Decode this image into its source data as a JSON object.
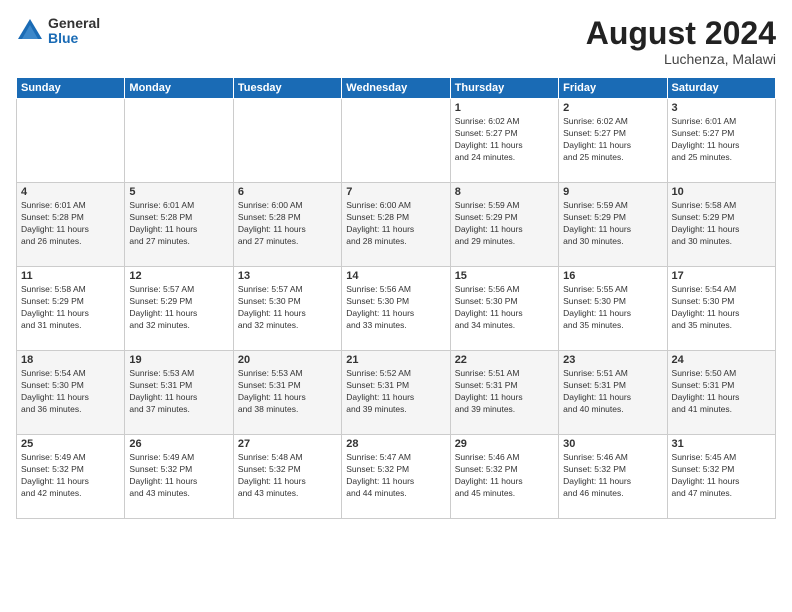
{
  "logo": {
    "general": "General",
    "blue": "Blue"
  },
  "title": "August 2024",
  "location": "Luchenza, Malawi",
  "days_of_week": [
    "Sunday",
    "Monday",
    "Tuesday",
    "Wednesday",
    "Thursday",
    "Friday",
    "Saturday"
  ],
  "weeks": [
    [
      {
        "day": "",
        "info": ""
      },
      {
        "day": "",
        "info": ""
      },
      {
        "day": "",
        "info": ""
      },
      {
        "day": "",
        "info": ""
      },
      {
        "day": "1",
        "info": "Sunrise: 6:02 AM\nSunset: 5:27 PM\nDaylight: 11 hours\nand 24 minutes."
      },
      {
        "day": "2",
        "info": "Sunrise: 6:02 AM\nSunset: 5:27 PM\nDaylight: 11 hours\nand 25 minutes."
      },
      {
        "day": "3",
        "info": "Sunrise: 6:01 AM\nSunset: 5:27 PM\nDaylight: 11 hours\nand 25 minutes."
      }
    ],
    [
      {
        "day": "4",
        "info": "Sunrise: 6:01 AM\nSunset: 5:28 PM\nDaylight: 11 hours\nand 26 minutes."
      },
      {
        "day": "5",
        "info": "Sunrise: 6:01 AM\nSunset: 5:28 PM\nDaylight: 11 hours\nand 27 minutes."
      },
      {
        "day": "6",
        "info": "Sunrise: 6:00 AM\nSunset: 5:28 PM\nDaylight: 11 hours\nand 27 minutes."
      },
      {
        "day": "7",
        "info": "Sunrise: 6:00 AM\nSunset: 5:28 PM\nDaylight: 11 hours\nand 28 minutes."
      },
      {
        "day": "8",
        "info": "Sunrise: 5:59 AM\nSunset: 5:29 PM\nDaylight: 11 hours\nand 29 minutes."
      },
      {
        "day": "9",
        "info": "Sunrise: 5:59 AM\nSunset: 5:29 PM\nDaylight: 11 hours\nand 30 minutes."
      },
      {
        "day": "10",
        "info": "Sunrise: 5:58 AM\nSunset: 5:29 PM\nDaylight: 11 hours\nand 30 minutes."
      }
    ],
    [
      {
        "day": "11",
        "info": "Sunrise: 5:58 AM\nSunset: 5:29 PM\nDaylight: 11 hours\nand 31 minutes."
      },
      {
        "day": "12",
        "info": "Sunrise: 5:57 AM\nSunset: 5:29 PM\nDaylight: 11 hours\nand 32 minutes."
      },
      {
        "day": "13",
        "info": "Sunrise: 5:57 AM\nSunset: 5:30 PM\nDaylight: 11 hours\nand 32 minutes."
      },
      {
        "day": "14",
        "info": "Sunrise: 5:56 AM\nSunset: 5:30 PM\nDaylight: 11 hours\nand 33 minutes."
      },
      {
        "day": "15",
        "info": "Sunrise: 5:56 AM\nSunset: 5:30 PM\nDaylight: 11 hours\nand 34 minutes."
      },
      {
        "day": "16",
        "info": "Sunrise: 5:55 AM\nSunset: 5:30 PM\nDaylight: 11 hours\nand 35 minutes."
      },
      {
        "day": "17",
        "info": "Sunrise: 5:54 AM\nSunset: 5:30 PM\nDaylight: 11 hours\nand 35 minutes."
      }
    ],
    [
      {
        "day": "18",
        "info": "Sunrise: 5:54 AM\nSunset: 5:30 PM\nDaylight: 11 hours\nand 36 minutes."
      },
      {
        "day": "19",
        "info": "Sunrise: 5:53 AM\nSunset: 5:31 PM\nDaylight: 11 hours\nand 37 minutes."
      },
      {
        "day": "20",
        "info": "Sunrise: 5:53 AM\nSunset: 5:31 PM\nDaylight: 11 hours\nand 38 minutes."
      },
      {
        "day": "21",
        "info": "Sunrise: 5:52 AM\nSunset: 5:31 PM\nDaylight: 11 hours\nand 39 minutes."
      },
      {
        "day": "22",
        "info": "Sunrise: 5:51 AM\nSunset: 5:31 PM\nDaylight: 11 hours\nand 39 minutes."
      },
      {
        "day": "23",
        "info": "Sunrise: 5:51 AM\nSunset: 5:31 PM\nDaylight: 11 hours\nand 40 minutes."
      },
      {
        "day": "24",
        "info": "Sunrise: 5:50 AM\nSunset: 5:31 PM\nDaylight: 11 hours\nand 41 minutes."
      }
    ],
    [
      {
        "day": "25",
        "info": "Sunrise: 5:49 AM\nSunset: 5:32 PM\nDaylight: 11 hours\nand 42 minutes."
      },
      {
        "day": "26",
        "info": "Sunrise: 5:49 AM\nSunset: 5:32 PM\nDaylight: 11 hours\nand 43 minutes."
      },
      {
        "day": "27",
        "info": "Sunrise: 5:48 AM\nSunset: 5:32 PM\nDaylight: 11 hours\nand 43 minutes."
      },
      {
        "day": "28",
        "info": "Sunrise: 5:47 AM\nSunset: 5:32 PM\nDaylight: 11 hours\nand 44 minutes."
      },
      {
        "day": "29",
        "info": "Sunrise: 5:46 AM\nSunset: 5:32 PM\nDaylight: 11 hours\nand 45 minutes."
      },
      {
        "day": "30",
        "info": "Sunrise: 5:46 AM\nSunset: 5:32 PM\nDaylight: 11 hours\nand 46 minutes."
      },
      {
        "day": "31",
        "info": "Sunrise: 5:45 AM\nSunset: 5:32 PM\nDaylight: 11 hours\nand 47 minutes."
      }
    ]
  ]
}
